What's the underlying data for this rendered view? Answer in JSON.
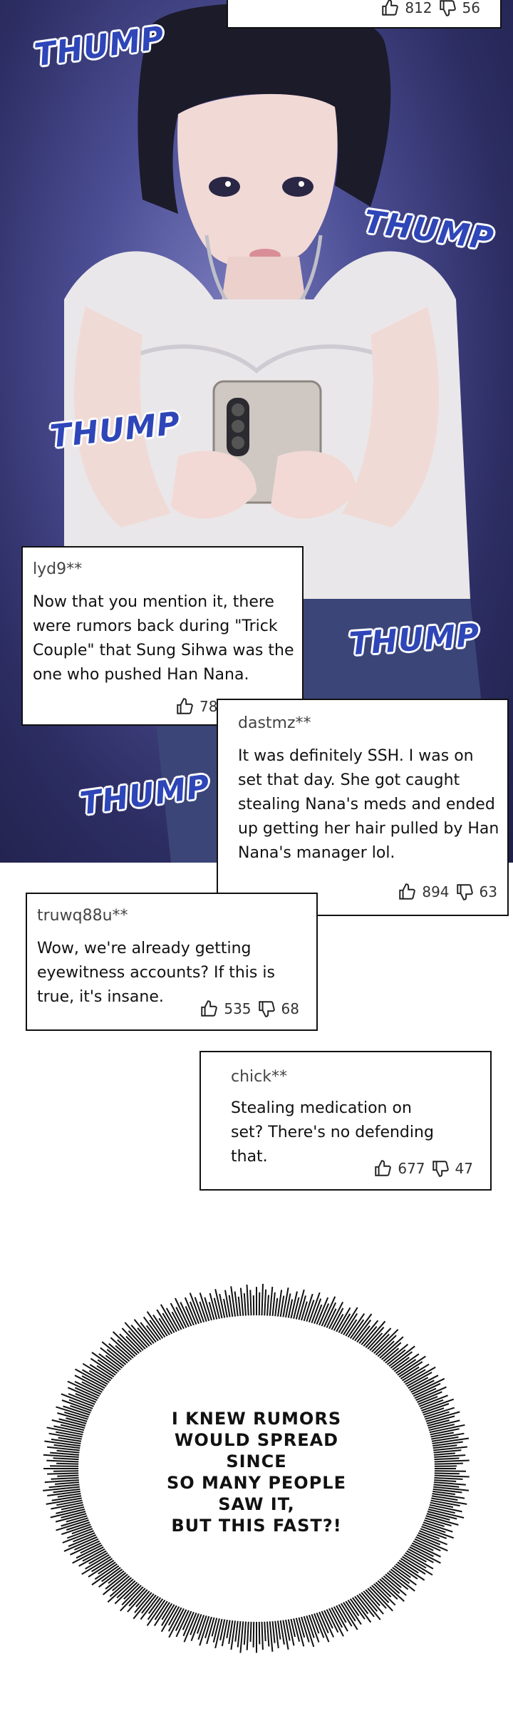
{
  "sound_effects": [
    "THUMP",
    "THUMP",
    "THUMP",
    "THUMP",
    "THUMP"
  ],
  "comments": [
    {
      "user": "",
      "text": "",
      "likes": "812",
      "dislikes": "56"
    },
    {
      "user": "lyd9**",
      "text": "Now that you mention it, there were rumors back during \"Trick Couple\" that Sung Sihwa was the one who pushed Han Nana.",
      "likes": "78",
      "dislikes": ""
    },
    {
      "user": "dastmz**",
      "text": "It was definitely SSH. I was on set that day. She got caught stealing Nana's meds and ended up getting her hair pulled by Han Nana's manager lol.",
      "likes": "894",
      "dislikes": "63"
    },
    {
      "user": "truwq88u**",
      "text": "Wow, we're already getting eyewitness accounts? If this is true, it's insane.",
      "likes": "535",
      "dislikes": "68"
    },
    {
      "user": "chick**",
      "text": "Stealing medication on set? There's no defending that.",
      "likes": "677",
      "dislikes": "47"
    }
  ],
  "thought_bubble": {
    "lines": [
      "I KNEW RUMORS",
      "WOULD SPREAD SINCE",
      "SO MANY PEOPLE SAW IT,",
      "BUT THIS FAST?!"
    ]
  },
  "colors": {
    "sfx": "#2e46b8",
    "night_bg": "#2c2d62"
  }
}
